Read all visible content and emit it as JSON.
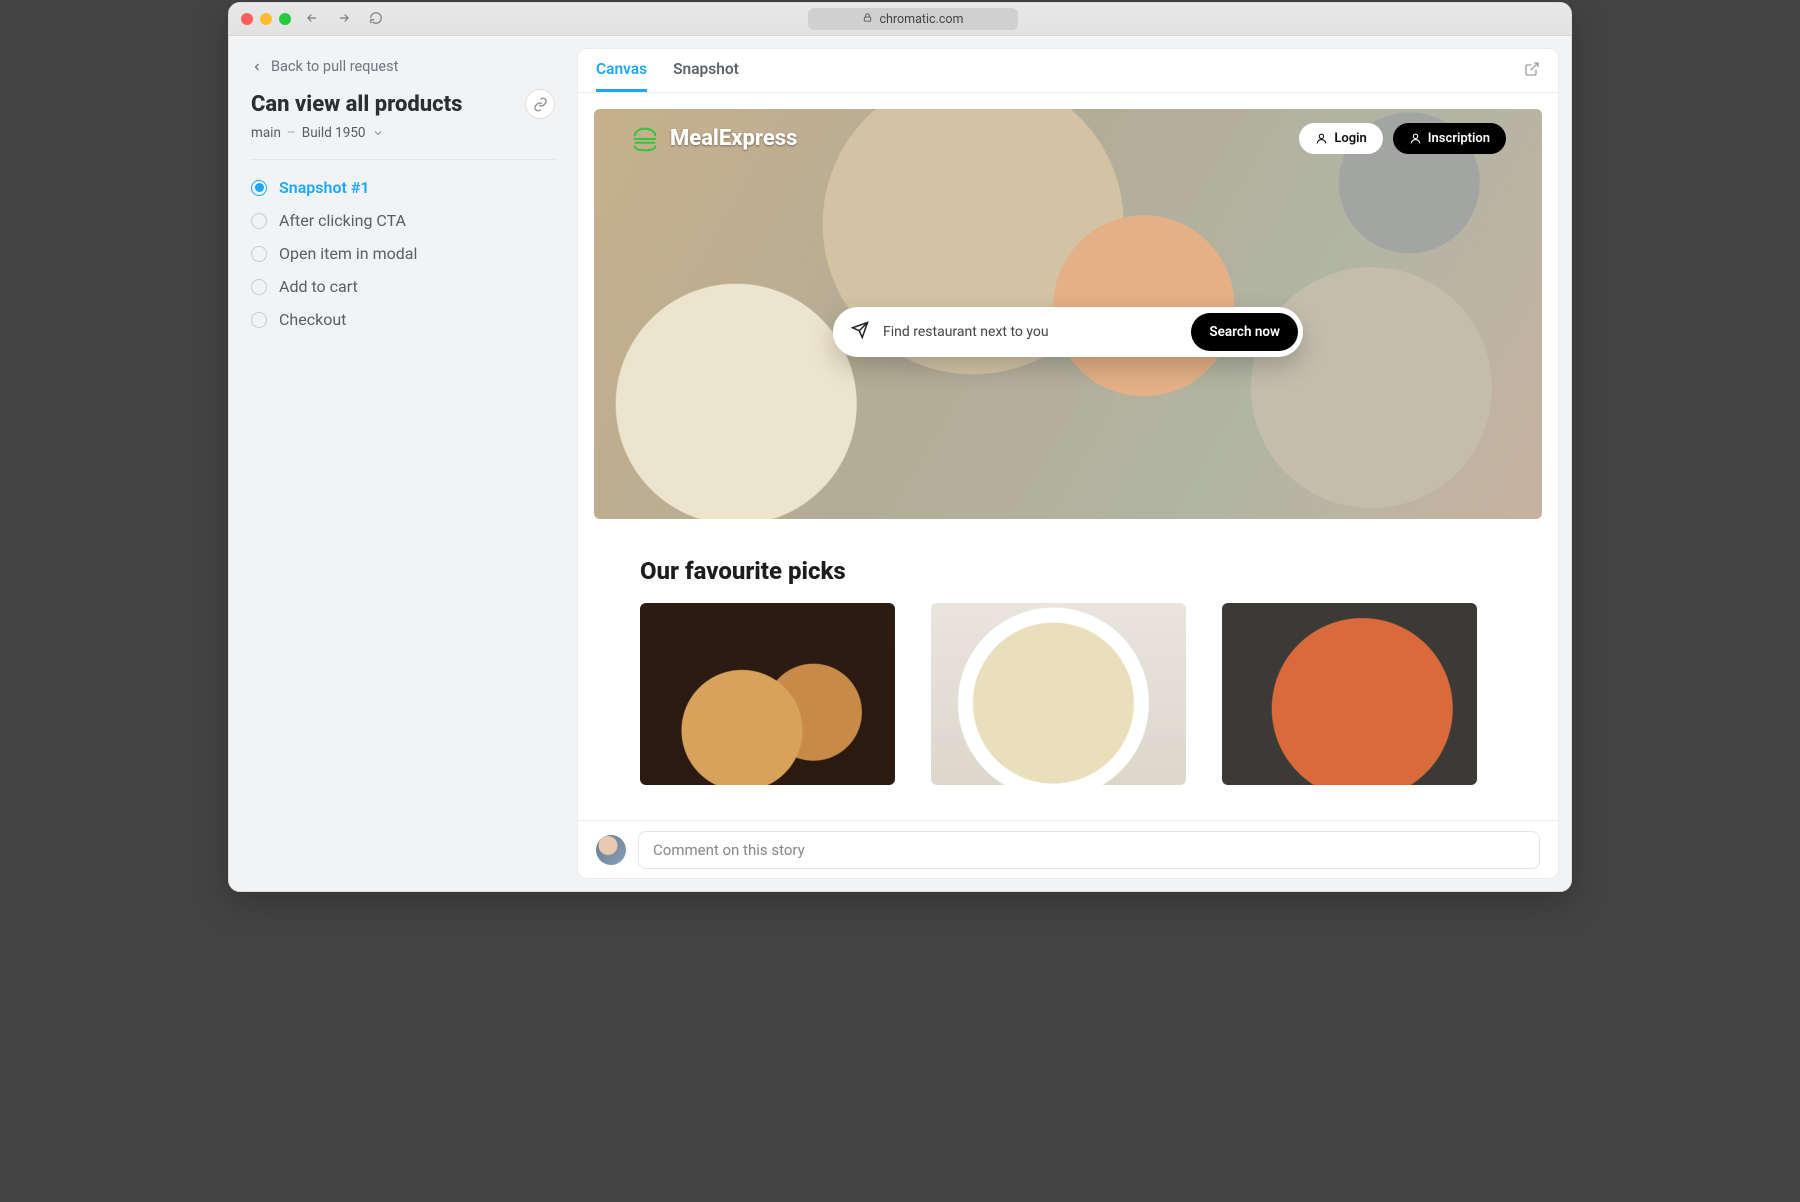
{
  "browser": {
    "url_host": "chromatic.com"
  },
  "sidebar": {
    "back_label": "Back to pull request",
    "title": "Can view all products",
    "branch": "main",
    "build_label": "Build 1950",
    "snapshots": [
      {
        "label": "Snapshot #1",
        "active": true
      },
      {
        "label": "After clicking CTA",
        "active": false
      },
      {
        "label": "Open item in modal",
        "active": false
      },
      {
        "label": "Add to cart",
        "active": false
      },
      {
        "label": "Checkout",
        "active": false
      }
    ]
  },
  "tabs": {
    "canvas": "Canvas",
    "snapshot": "Snapshot"
  },
  "hero": {
    "brand": "MealExpress",
    "login": "Login",
    "signup": "Inscription",
    "search_placeholder": "Find restaurant next to you",
    "search_button": "Search now"
  },
  "picks": {
    "title": "Our favourite picks"
  },
  "comment": {
    "placeholder": "Comment on this story"
  }
}
